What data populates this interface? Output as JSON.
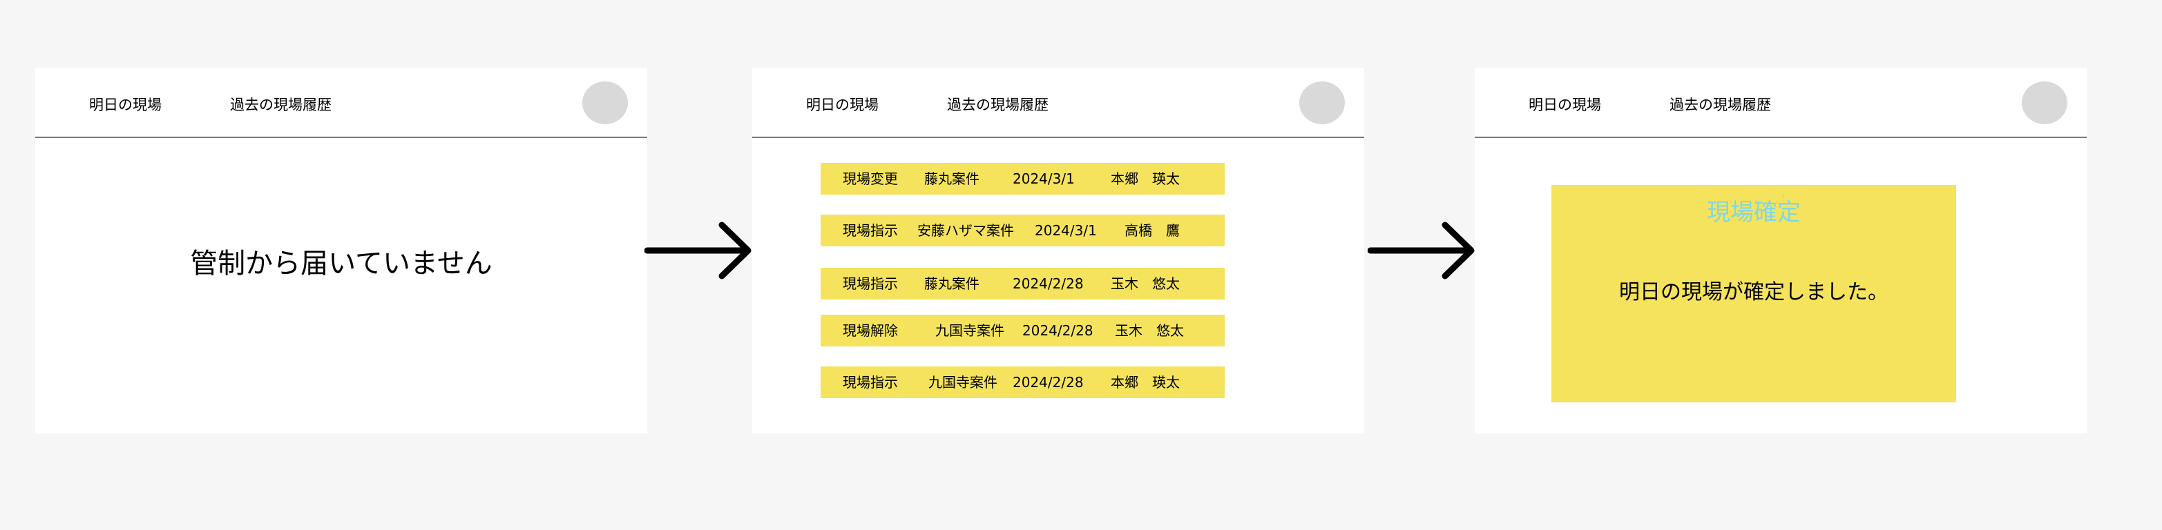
{
  "nav": {
    "today_site": "明日の現場",
    "history": "過去の現場履歴"
  },
  "screen_empty": {
    "message": "管制から届いていません"
  },
  "screen_list": {
    "notifications": [
      {
        "type": "現場変更",
        "project": "藤丸案件",
        "date": "2024/3/1",
        "person": "本郷　瑛太"
      },
      {
        "type": "現場指示",
        "project": "安藤ハザマ案件",
        "date": "2024/3/1",
        "person": "高橋　鷹"
      },
      {
        "type": "現場指示",
        "project": "藤丸案件",
        "date": "2024/2/28",
        "person": "玉木　悠太"
      },
      {
        "type": "現場解除",
        "project": "九国寺案件",
        "date": "2024/2/28",
        "person": "玉木　悠太"
      },
      {
        "type": "現場指示",
        "project": "九国寺案件",
        "date": "2024/2/28",
        "person": "本郷　瑛太"
      }
    ]
  },
  "screen_confirm": {
    "title": "現場確定",
    "message": "明日の現場が確定しました。"
  },
  "colors": {
    "background": "#f6f6f6",
    "card_yellow": "#f5e35d",
    "title_cyan": "#7fd8e6",
    "avatar_gray": "#d9d9d9"
  }
}
